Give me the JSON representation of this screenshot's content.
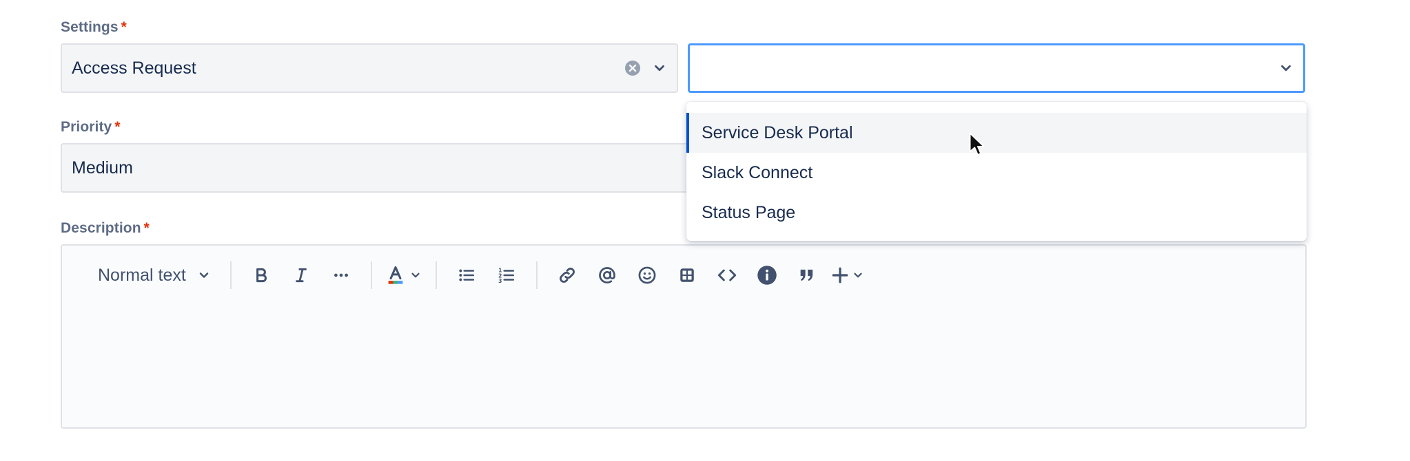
{
  "settings": {
    "label": "Settings",
    "required_mark": "*",
    "value": "Access Request",
    "second_value": ""
  },
  "priority": {
    "label": "Priority",
    "required_mark": "*",
    "value": "Medium"
  },
  "description": {
    "label": "Description",
    "required_mark": "*",
    "text_style": "Normal text"
  },
  "dropdown": {
    "options": [
      "Service Desk Portal",
      "Slack Connect",
      "Status Page"
    ],
    "hovered_index": 0
  },
  "toolbar_icons": [
    "bold-icon",
    "italic-icon",
    "more-formatting-icon",
    "text-color-icon",
    "bullet-list-icon",
    "numbered-list-icon",
    "link-icon",
    "mention-icon",
    "emoji-icon",
    "table-icon",
    "code-icon",
    "info-panel-icon",
    "quote-icon",
    "insert-plus-icon"
  ],
  "colors": {
    "accent": "#0052cc",
    "focus_border": "#4c9aff",
    "required": "#de350b",
    "label": "#5e6c84",
    "text": "#172b4d"
  }
}
